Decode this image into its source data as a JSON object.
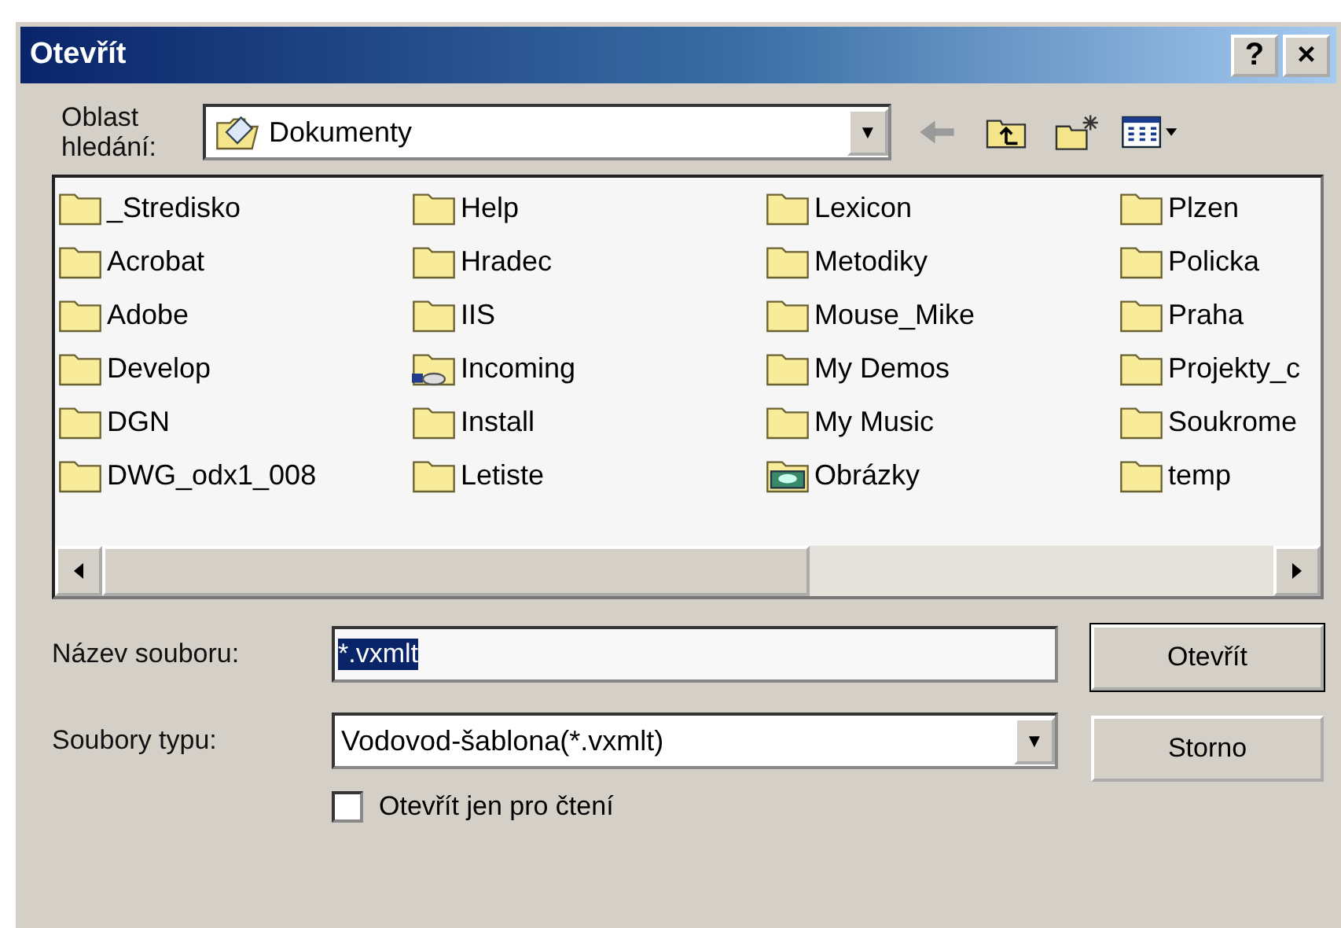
{
  "window": {
    "title": "Otevřít",
    "help_button": "?",
    "close_button": "×"
  },
  "look_in": {
    "label": "Oblast hledání:",
    "value": "Dokumenty",
    "dropdown_arrow": "▼"
  },
  "files": [
    {
      "name": "_Stredisko",
      "kind": "folder"
    },
    {
      "name": "Acrobat",
      "kind": "folder"
    },
    {
      "name": "Adobe",
      "kind": "folder"
    },
    {
      "name": "Develop",
      "kind": "folder"
    },
    {
      "name": "DGN",
      "kind": "folder"
    },
    {
      "name": "DWG_odx1_008",
      "kind": "folder"
    },
    {
      "name": "Help",
      "kind": "folder"
    },
    {
      "name": "Hradec",
      "kind": "folder"
    },
    {
      "name": "IIS",
      "kind": "folder"
    },
    {
      "name": "Incoming",
      "kind": "shared"
    },
    {
      "name": "Install",
      "kind": "folder"
    },
    {
      "name": "Letiste",
      "kind": "folder"
    },
    {
      "name": "Lexicon",
      "kind": "folder"
    },
    {
      "name": "Metodiky",
      "kind": "folder"
    },
    {
      "name": "Mouse_Mike",
      "kind": "folder"
    },
    {
      "name": "My Demos",
      "kind": "folder"
    },
    {
      "name": "My Music",
      "kind": "folder"
    },
    {
      "name": "Obrázky",
      "kind": "pictures"
    },
    {
      "name": "Plzen",
      "kind": "folder"
    },
    {
      "name": "Policka",
      "kind": "folder"
    },
    {
      "name": "Praha",
      "kind": "folder"
    },
    {
      "name": "Projekty_c",
      "kind": "folder"
    },
    {
      "name": "Soukrome",
      "kind": "folder"
    },
    {
      "name": "temp",
      "kind": "folder"
    }
  ],
  "file_name": {
    "label": "Název souboru:",
    "value": "*.vxmlt"
  },
  "file_type": {
    "label": "Soubory typu:",
    "value": "Vodovod-šablona(*.vxmlt)",
    "dropdown_arrow": "▼"
  },
  "read_only": {
    "label": "Otevřít jen pro čtení",
    "checked": false
  },
  "buttons": [
    "Otevřít",
    "Storno"
  ]
}
